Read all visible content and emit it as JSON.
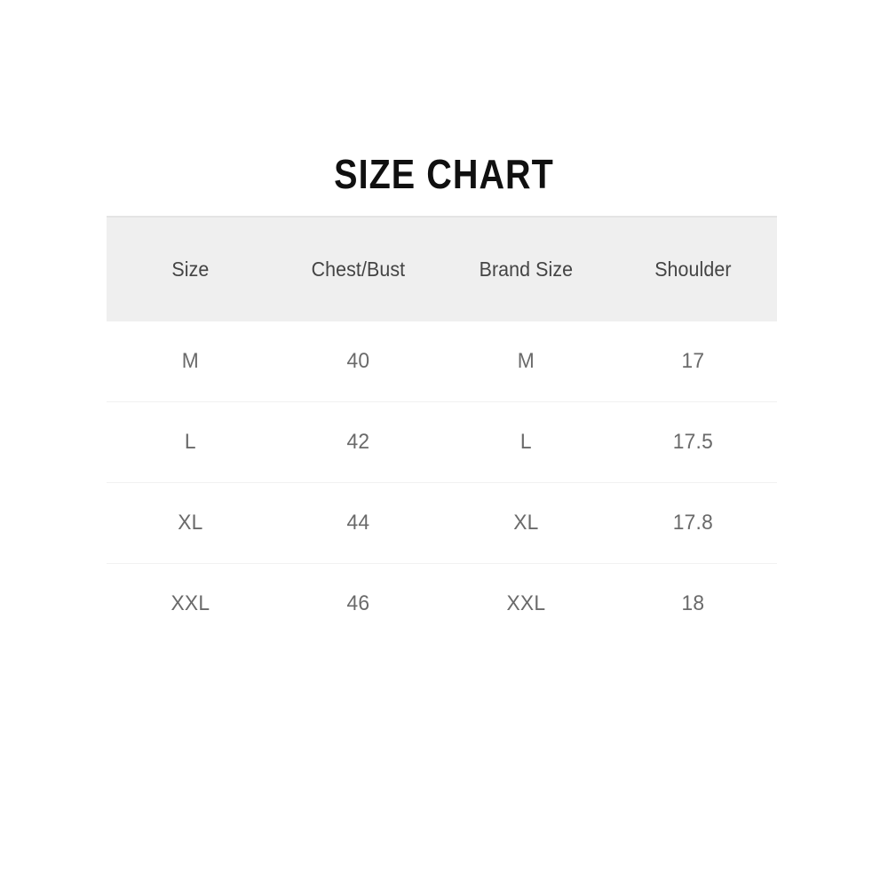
{
  "title": "SIZE CHART",
  "colors": {
    "page_background": "#ffffff",
    "title_text": "#101010",
    "header_band": "#efefef",
    "header_band_top_edge": "#e4e4e4",
    "header_text": "#444444",
    "body_text": "#6a6a6a",
    "row_divider": "#f1f1f1"
  },
  "table": {
    "columns": [
      {
        "label": "Size"
      },
      {
        "label": "Chest/Bust"
      },
      {
        "label": "Brand Size"
      },
      {
        "label": "Shoulder"
      }
    ],
    "rows": [
      {
        "size": "M",
        "chest_bust": "40",
        "brand_size": "M",
        "shoulder": "17"
      },
      {
        "size": "L",
        "chest_bust": "42",
        "brand_size": "L",
        "shoulder": "17.5"
      },
      {
        "size": "XL",
        "chest_bust": "44",
        "brand_size": "XL",
        "shoulder": "17.8"
      },
      {
        "size": "XXL",
        "chest_bust": "46",
        "brand_size": "XXL",
        "shoulder": "18"
      }
    ]
  },
  "chart_data": {
    "type": "table",
    "title": "SIZE CHART",
    "columns": [
      "Size",
      "Chest/Bust",
      "Brand Size",
      "Shoulder"
    ],
    "rows": [
      [
        "M",
        "40",
        "M",
        "17"
      ],
      [
        "L",
        "42",
        "L",
        "17.5"
      ],
      [
        "XL",
        "44",
        "XL",
        "17.8"
      ],
      [
        "XXL",
        "46",
        "XXL",
        "18"
      ]
    ],
    "series": [
      {
        "name": "Chest/Bust",
        "categories": [
          "M",
          "L",
          "XL",
          "XXL"
        ],
        "values": [
          40,
          42,
          44,
          46
        ]
      },
      {
        "name": "Shoulder",
        "categories": [
          "M",
          "L",
          "XL",
          "XXL"
        ],
        "values": [
          17,
          17.5,
          17.8,
          18
        ]
      }
    ],
    "xlabel": "Size",
    "ylabel": "",
    "grid": false,
    "legend": "none"
  }
}
